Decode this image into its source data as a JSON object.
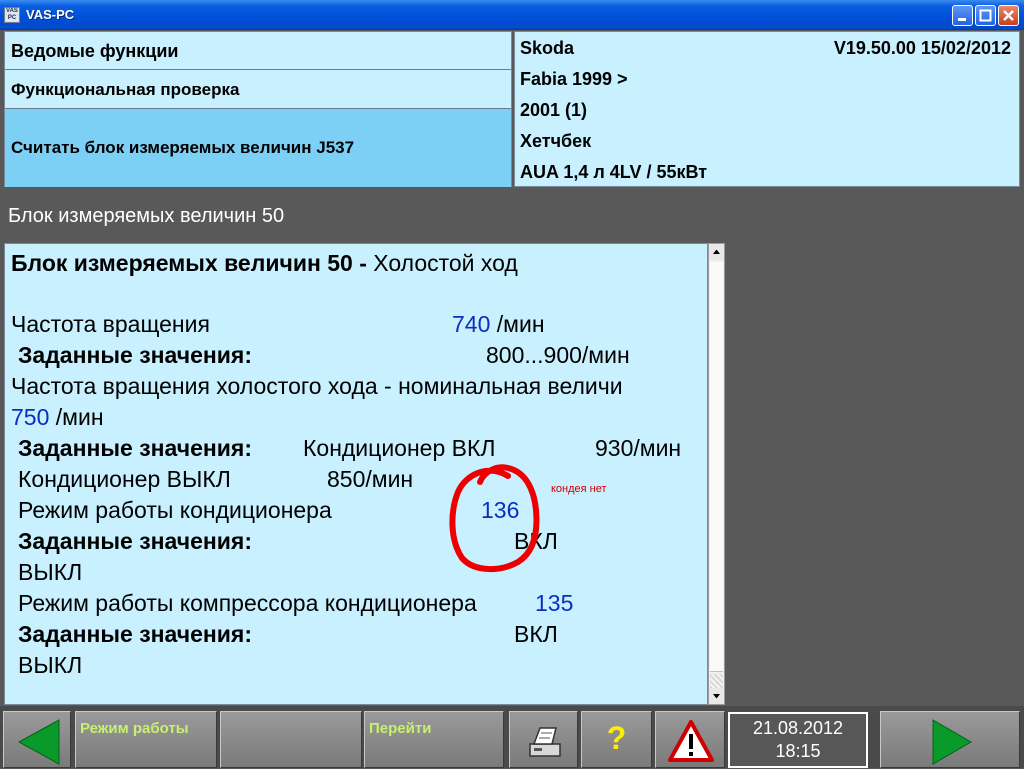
{
  "window": {
    "title": "VAS-PC",
    "icon": "vas-pc-app-icon",
    "icon_text": "VAS PC"
  },
  "header": {
    "rows": [
      "Ведомые функции",
      "Функциональная проверка",
      "Считать блок измеряемых величин J537"
    ],
    "vehicle": {
      "make": "Skoda",
      "version": "V19.50.00 15/02/2012",
      "model": "Fabia 1999 >",
      "year": "2001 (1)",
      "body": "Хетчбек",
      "engine": "AUA 1,4 л 4LV / 55кВт"
    }
  },
  "section_title": "Блок измеряемых величин 50",
  "content": {
    "heading_bold": "Блок измеряемых величин 50 -",
    "heading_rest": " Холостой ход",
    "rpm_label": "Частота вращения",
    "rpm_value": "740",
    "rpm_unit": " /мин",
    "set_label": "Заданные значения:",
    "rpm_target": "800...900/мин",
    "idle_label": " Частота вращения холостого хода - номинальная величи",
    "idle_value": "750",
    "idle_unit": " /мин",
    "ac_on_label": "Кондиционер ВКЛ",
    "ac_on_target": "930/мин",
    "ac_off_label": "Кондиционер ВЫКЛ",
    "ac_off_target": "850/мин",
    "ac_mode_label": "Режим работы кондиционера",
    "ac_mode_value": "136",
    "on": "ВКЛ",
    "off": "ВЫКЛ",
    "comp_mode_label": "Режим работы компрессора кондиционера",
    "comp_mode_value": "135"
  },
  "annotation": {
    "text": "кондея нет",
    "color": "#e00000"
  },
  "toolbar": {
    "back_icon": "arrow-left-icon",
    "mode_label": "Режим работы",
    "goto_label": "Перейти",
    "print_icon": "printer-icon",
    "help_label": "?",
    "warning_icon": "warning-icon",
    "date": "21.08.2012",
    "time": "18:15",
    "forward_icon": "arrow-right-icon"
  },
  "colors": {
    "panel_bg": "#c8f0ff",
    "selected_row": "#7dd0f5",
    "value_blue": "#0a2fc0",
    "nav_green": "#0a9a2a"
  }
}
